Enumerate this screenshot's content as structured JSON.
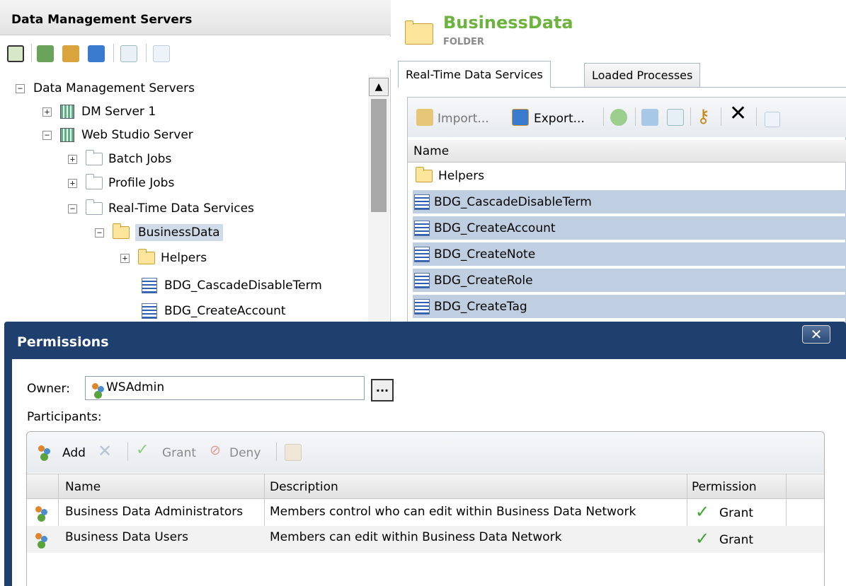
{
  "left_panel": {
    "title": "Data Management Servers",
    "tree": {
      "root": "Data Management Servers",
      "dm_server": "DM Server 1",
      "web_studio": "Web Studio Server",
      "batch_jobs": "Batch Jobs",
      "profile_jobs": "Profile Jobs",
      "rtds": "Real-Time Data Services",
      "business_data": "BusinessData",
      "helpers": "Helpers",
      "cascade": "BDG_CascadeDisableTerm",
      "create_account": "BDG_CreateAccount"
    }
  },
  "right_panel": {
    "title": "BusinessData",
    "subtitle": "FOLDER",
    "tabs": [
      "Real-Time Data Services",
      "Loaded Processes"
    ],
    "toolbar": {
      "import_label": "Import...",
      "export_label": "Export..."
    },
    "column_name": "Name",
    "rows": [
      "Helpers",
      "BDG_CascadeDisableTerm",
      "BDG_CreateAccount",
      "BDG_CreateNote",
      "BDG_CreateRole",
      "BDG_CreateTag"
    ]
  },
  "dialog": {
    "title": "Permissions",
    "close_glyph": "✕",
    "owner_label": "Owner:",
    "owner_value": "WSAdmin",
    "browse_label": "...",
    "participants_label": "Participants:",
    "toolbar": {
      "add": "Add",
      "grant": "Grant",
      "deny": "Deny"
    },
    "columns": {
      "name": "Name",
      "description": "Description",
      "permission": "Permission"
    },
    "rows": [
      {
        "name": "Business Data Administrators",
        "description": "Members control who can edit within Business Data Network",
        "permission": "Grant"
      },
      {
        "name": "Business Data Users",
        "description": "Members can edit within Business Data Network",
        "permission": "Grant"
      }
    ]
  },
  "colors": {
    "accent_green": "#6db33f",
    "dialog_frame": "#1f3f6f",
    "selection": "#bfcfe1"
  }
}
